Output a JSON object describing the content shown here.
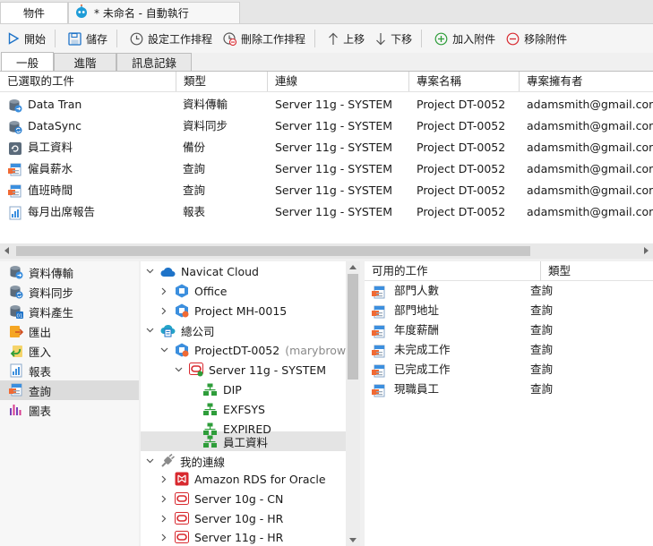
{
  "tabs": {
    "objects": "物件",
    "automation": "* 未命名 - 自動執行"
  },
  "toolbar": {
    "start": "開始",
    "save": "儲存",
    "set_schedule": "設定工作排程",
    "delete_schedule": "刪除工作排程",
    "move_up": "上移",
    "move_down": "下移",
    "add_attachment": "加入附件",
    "remove_attachment": "移除附件"
  },
  "subtabs": {
    "general": "一般",
    "advanced": "進階",
    "log": "訊息記錄"
  },
  "selected_jobs": {
    "headers": [
      "已選取的工件",
      "類型",
      "連線",
      "專案名稱",
      "專案擁有者"
    ],
    "rows": [
      {
        "name": "Data Tran",
        "type": "資料傳輸",
        "connection": "Server 11g - SYSTEM",
        "project": "Project DT-0052",
        "owner": "adamsmith@gmail.com",
        "icon": "data-transfer-icon"
      },
      {
        "name": "DataSync",
        "type": "資料同步",
        "connection": "Server 11g - SYSTEM",
        "project": "Project DT-0052",
        "owner": "adamsmith@gmail.com",
        "icon": "data-sync-icon"
      },
      {
        "name": "員工資料",
        "type": "備份",
        "connection": "Server 11g - SYSTEM",
        "project": "Project DT-0052",
        "owner": "adamsmith@gmail.com",
        "icon": "backup-icon"
      },
      {
        "name": "僱員薪水",
        "type": "查詢",
        "connection": "Server 11g - SYSTEM",
        "project": "Project DT-0052",
        "owner": "adamsmith@gmail.com",
        "icon": "query-icon"
      },
      {
        "name": "值班時間",
        "type": "查詢",
        "connection": "Server 11g - SYSTEM",
        "project": "Project DT-0052",
        "owner": "adamsmith@gmail.com",
        "icon": "query-icon"
      },
      {
        "name": "每月出席報告",
        "type": "報表",
        "connection": "Server 11g - SYSTEM",
        "project": "Project DT-0052",
        "owner": "adamsmith@gmail.com",
        "icon": "report-icon"
      }
    ]
  },
  "categories": [
    {
      "label": "資料傳輸",
      "icon": "data-transfer-icon"
    },
    {
      "label": "資料同步",
      "icon": "data-sync-icon"
    },
    {
      "label": "資料產生",
      "icon": "data-generation-icon"
    },
    {
      "label": "匯出",
      "icon": "export-icon"
    },
    {
      "label": "匯入",
      "icon": "import-icon"
    },
    {
      "label": "報表",
      "icon": "report-icon"
    },
    {
      "label": "查詢",
      "icon": "query-icon"
    },
    {
      "label": "圖表",
      "icon": "chart-icon"
    }
  ],
  "tree": {
    "navicat_cloud": "Navicat Cloud",
    "office": "Office",
    "project_mh": "Project MH-0015",
    "head_office": "總公司",
    "project_dt": "ProjectDT-0052",
    "project_dt_owner": "(marybrown@",
    "server_11g_system": "Server 11g - SYSTEM",
    "schema_dip": "DIP",
    "schema_exfsys": "EXFSYS",
    "schema_expired": "EXPIRED",
    "schema_employee": "員工資料",
    "my_connections": "我的連線",
    "amazon_rds": "Amazon RDS for Oracle",
    "server_10g_cn": "Server 10g - CN",
    "server_10g_hr": "Server 10g - HR",
    "server_11g_hr": "Server 11g - HR"
  },
  "available_jobs": {
    "headers": [
      "可用的工作",
      "類型"
    ],
    "rows": [
      {
        "name": "部門人數",
        "type": "查詢"
      },
      {
        "name": "部門地址",
        "type": "查詢"
      },
      {
        "name": "年度薪酬",
        "type": "查詢"
      },
      {
        "name": "未完成工作",
        "type": "查詢"
      },
      {
        "name": "已完成工作",
        "type": "查詢"
      },
      {
        "name": "現職員工",
        "type": "查詢"
      }
    ]
  },
  "colors": {
    "accent_blue": "#1e73c8",
    "green": "#2e9d3a",
    "red": "#d8292f"
  }
}
